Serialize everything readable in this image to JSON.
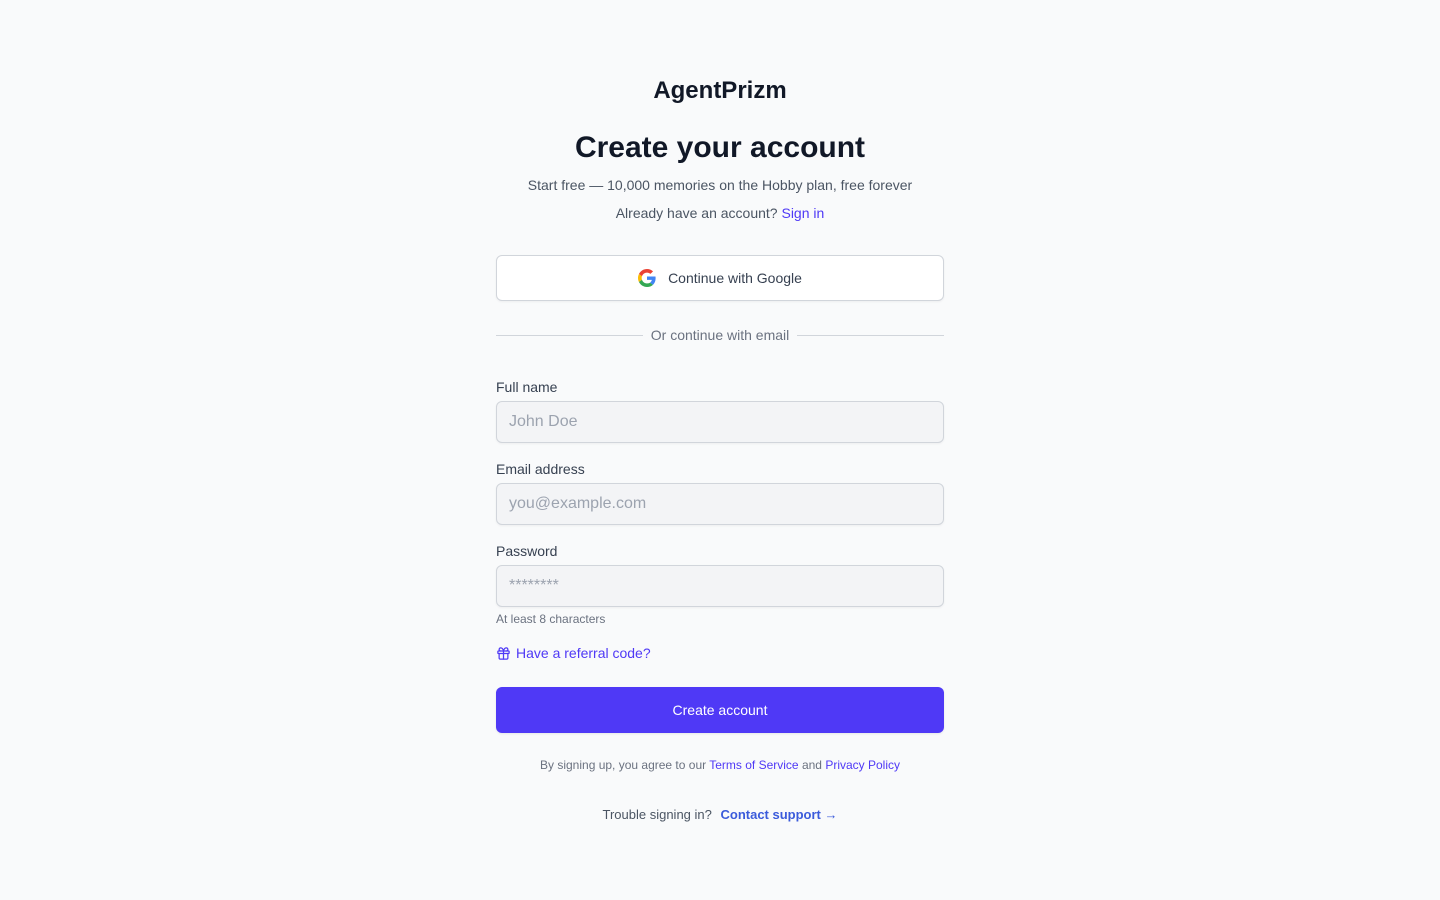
{
  "brand": {
    "name": "AgentPrizm"
  },
  "header": {
    "title": "Create your account",
    "subtitle": "Start free — 10,000 memories on the Hobby plan, free forever",
    "signin_prompt": "Already have an account?",
    "signin_link": "Sign in"
  },
  "oauth": {
    "google_label": "Continue with Google",
    "google_icon": "google-icon"
  },
  "divider": {
    "text": "Or continue with email"
  },
  "form": {
    "full_name": {
      "label": "Full name",
      "placeholder": "John Doe",
      "value": ""
    },
    "email": {
      "label": "Email address",
      "placeholder": "you@example.com",
      "value": ""
    },
    "password": {
      "label": "Password",
      "placeholder": "********",
      "value": "",
      "hint": "At least 8 characters"
    },
    "referral": {
      "label": "Have a referral code?",
      "icon": "gift-icon"
    },
    "submit_label": "Create account"
  },
  "legal": {
    "prefix": "By signing up, you agree to our",
    "terms_link": "Terms of Service",
    "and": "and",
    "privacy_link": "Privacy Policy"
  },
  "support": {
    "prompt": "Trouble signing in?",
    "link": "Contact support →"
  },
  "colors": {
    "accent": "#4f39f6",
    "background": "#f9fafb",
    "support_link": "#3b5bdb"
  }
}
